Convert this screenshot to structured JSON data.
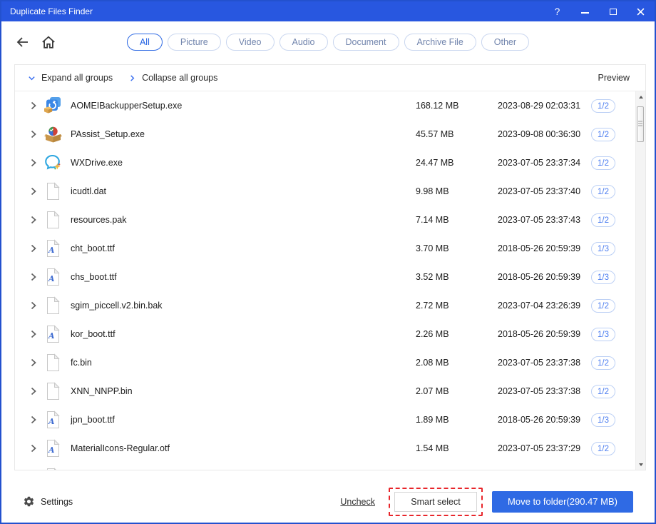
{
  "window": {
    "title": "Duplicate Files Finder",
    "controls": {
      "help": "?"
    }
  },
  "filters": {
    "tabs": [
      {
        "label": "All",
        "selected": true
      },
      {
        "label": "Picture",
        "selected": false
      },
      {
        "label": "Video",
        "selected": false
      },
      {
        "label": "Audio",
        "selected": false
      },
      {
        "label": "Document",
        "selected": false
      },
      {
        "label": "Archive File",
        "selected": false
      },
      {
        "label": "Other",
        "selected": false
      }
    ]
  },
  "toolbar": {
    "expand_all": "Expand all groups",
    "collapse_all": "Collapse all groups",
    "preview": "Preview"
  },
  "files": [
    {
      "icon": "aomei-app",
      "name": "AOMEIBackupperSetup.exe",
      "size": "168.12 MB",
      "date": "2023-08-29 02:03:31",
      "badge": "1/2"
    },
    {
      "icon": "passist-app",
      "name": "PAssist_Setup.exe",
      "size": "45.57 MB",
      "date": "2023-09-08 00:36:30",
      "badge": "1/2"
    },
    {
      "icon": "wxdrive-app",
      "name": "WXDrive.exe",
      "size": "24.47 MB",
      "date": "2023-07-05 23:37:34",
      "badge": "1/2"
    },
    {
      "icon": "document",
      "name": "icudtl.dat",
      "size": "9.98 MB",
      "date": "2023-07-05 23:37:40",
      "badge": "1/2"
    },
    {
      "icon": "document",
      "name": "resources.pak",
      "size": "7.14 MB",
      "date": "2023-07-05 23:37:43",
      "badge": "1/2"
    },
    {
      "icon": "font-file",
      "name": "cht_boot.ttf",
      "size": "3.70 MB",
      "date": "2018-05-26 20:59:39",
      "badge": "1/3"
    },
    {
      "icon": "font-file",
      "name": "chs_boot.ttf",
      "size": "3.52 MB",
      "date": "2018-05-26 20:59:39",
      "badge": "1/3"
    },
    {
      "icon": "document",
      "name": "sgim_piccell.v2.bin.bak",
      "size": "2.72 MB",
      "date": "2023-07-04 23:26:39",
      "badge": "1/2"
    },
    {
      "icon": "font-file",
      "name": "kor_boot.ttf",
      "size": "2.26 MB",
      "date": "2018-05-26 20:59:39",
      "badge": "1/3"
    },
    {
      "icon": "document",
      "name": "fc.bin",
      "size": "2.08 MB",
      "date": "2023-07-05 23:37:38",
      "badge": "1/2"
    },
    {
      "icon": "document",
      "name": "XNN_NNPP.bin",
      "size": "2.07 MB",
      "date": "2023-07-05 23:37:38",
      "badge": "1/2"
    },
    {
      "icon": "font-file",
      "name": "jpn_boot.ttf",
      "size": "1.89 MB",
      "date": "2018-05-26 20:59:39",
      "badge": "1/3"
    },
    {
      "icon": "font-file",
      "name": "MaterialIcons-Regular.otf",
      "size": "1.54 MB",
      "date": "2023-07-05 23:37:29",
      "badge": "1/2"
    },
    {
      "icon": "document",
      "name": "",
      "size": "",
      "date": "",
      "badge": ""
    }
  ],
  "footer": {
    "settings": "Settings",
    "uncheck": "Uncheck",
    "smart_select": "Smart select",
    "move_to_folder": "Move to folder(290.47 MB)"
  },
  "colors": {
    "titlebar": "#2857e0",
    "accent": "#2f6ae4",
    "badge": "#4a7cf0",
    "annotation": "#e8262b"
  }
}
